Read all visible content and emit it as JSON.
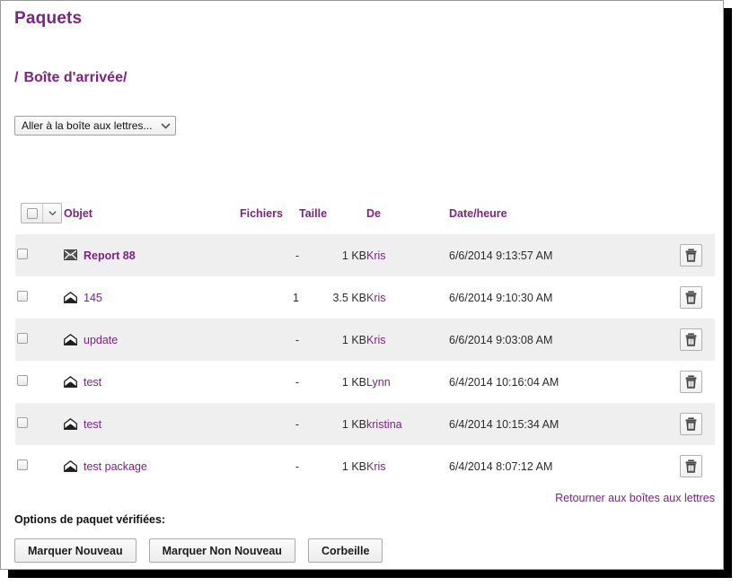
{
  "window": {
    "title": "Paquets"
  },
  "breadcrumb": {
    "separator": "/",
    "current": "Boîte d'arrivée/"
  },
  "mailbox_select": {
    "selected": "Aller à la boîte aux lettres...",
    "icon": "chevron-down-icon"
  },
  "table": {
    "select_all": {
      "checkbox_icon": "checkbox-icon",
      "dropdown_icon": "chevron-down-icon"
    },
    "headers": {
      "object": "Objet",
      "files": "Fichiers",
      "size": "Taille",
      "from": "De",
      "datetime": "Date/heure"
    },
    "rows": [
      {
        "object": "Report 88",
        "unread": true,
        "envelope_icon": "envelope-closed-icon",
        "files": "-",
        "size": "1 KB",
        "from": "Kris",
        "datetime": "6/6/2014 9:13:57 AM",
        "delete_icon": "trash-icon"
      },
      {
        "object": "145",
        "unread": false,
        "envelope_icon": "envelope-open-icon",
        "files": "1",
        "size": "3.5 KB",
        "from": "Kris",
        "datetime": "6/6/2014 9:10:30 AM",
        "delete_icon": "trash-icon"
      },
      {
        "object": "update",
        "unread": false,
        "envelope_icon": "envelope-open-icon",
        "files": "-",
        "size": "1 KB",
        "from": "Kris",
        "datetime": "6/6/2014 9:03:08 AM",
        "delete_icon": "trash-icon"
      },
      {
        "object": "test",
        "unread": false,
        "envelope_icon": "envelope-open-icon",
        "files": "-",
        "size": "1 KB",
        "from": "Lynn",
        "datetime": "6/4/2014 10:16:04 AM",
        "delete_icon": "trash-icon"
      },
      {
        "object": "test",
        "unread": false,
        "envelope_icon": "envelope-open-icon",
        "files": "-",
        "size": "1 KB",
        "from": "kristina",
        "datetime": "6/4/2014 10:15:34 AM",
        "delete_icon": "trash-icon"
      },
      {
        "object": "test package",
        "unread": false,
        "envelope_icon": "envelope-open-icon",
        "files": "-",
        "size": "1 KB",
        "from": "Kris",
        "datetime": "6/4/2014 8:07:12 AM",
        "delete_icon": "trash-icon"
      }
    ]
  },
  "footer": {
    "return_link": "Retourner aux boîtes aux lettres",
    "options_label": "Options de paquet vérifiées:",
    "buttons": [
      {
        "label": "Marquer Nouveau"
      },
      {
        "label": "Marquer Non Nouveau"
      },
      {
        "label": "Corbeille"
      }
    ]
  },
  "colors": {
    "accent_purple": "#7b2481",
    "row_alt": "#efefef",
    "text": "#2b2b2b",
    "border": "#9a9a9a"
  }
}
